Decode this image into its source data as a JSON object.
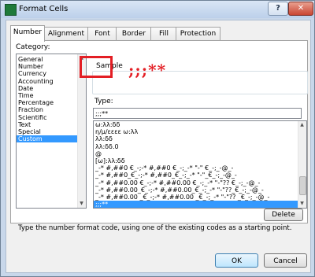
{
  "window": {
    "title": "Format Cells",
    "help_label": "?",
    "close_label": "✕"
  },
  "tabs": [
    "Number",
    "Alignment",
    "Font",
    "Border",
    "Fill",
    "Protection"
  ],
  "category": {
    "label": "Category:",
    "items": [
      "General",
      "Number",
      "Currency",
      "Accounting",
      "Date",
      "Time",
      "Percentage",
      "Fraction",
      "Scientific",
      "Text",
      "Special",
      "Custom"
    ],
    "selected": "Custom"
  },
  "sample": {
    "label": "Sample"
  },
  "type": {
    "label": "Type:",
    "value": ";;;**"
  },
  "annotation": {
    "text": ";;;**"
  },
  "format_codes": [
    "ω:λλ:δδ",
    "η/μ/εεεε ω:λλ",
    "λλ:δδ",
    "λλ:δδ.0",
    "@",
    "[ω]:λλ:δδ",
    "_-* #,##0 €_-;-* #,##0 €_-;_-* \"-\" €_-;_-@_-",
    "_-* #,##0_€_-;-* #,##0_€_-;_-* \"-\"_€_-;_-@_-",
    "_-* #,##0.00 €_-;-* #,##0.00 €_-;_-* \"-\"?? €_-;_-@_-",
    "_-* #,##0.00_€_-;-* #,##0.00_€_-;_-* \"-\"??_€_-;_-@_-",
    "_-* #,##0.00 _€_-;-* #,##0.00 _€_-;_-* \"-\"?? _€_-;_-@_-",
    ";;;**"
  ],
  "selected_format": ";;;**",
  "delete_label": "Delete",
  "hint": "Type the number format code, using one of the existing codes as a starting point.",
  "ok_label": "OK",
  "cancel_label": "Cancel"
}
